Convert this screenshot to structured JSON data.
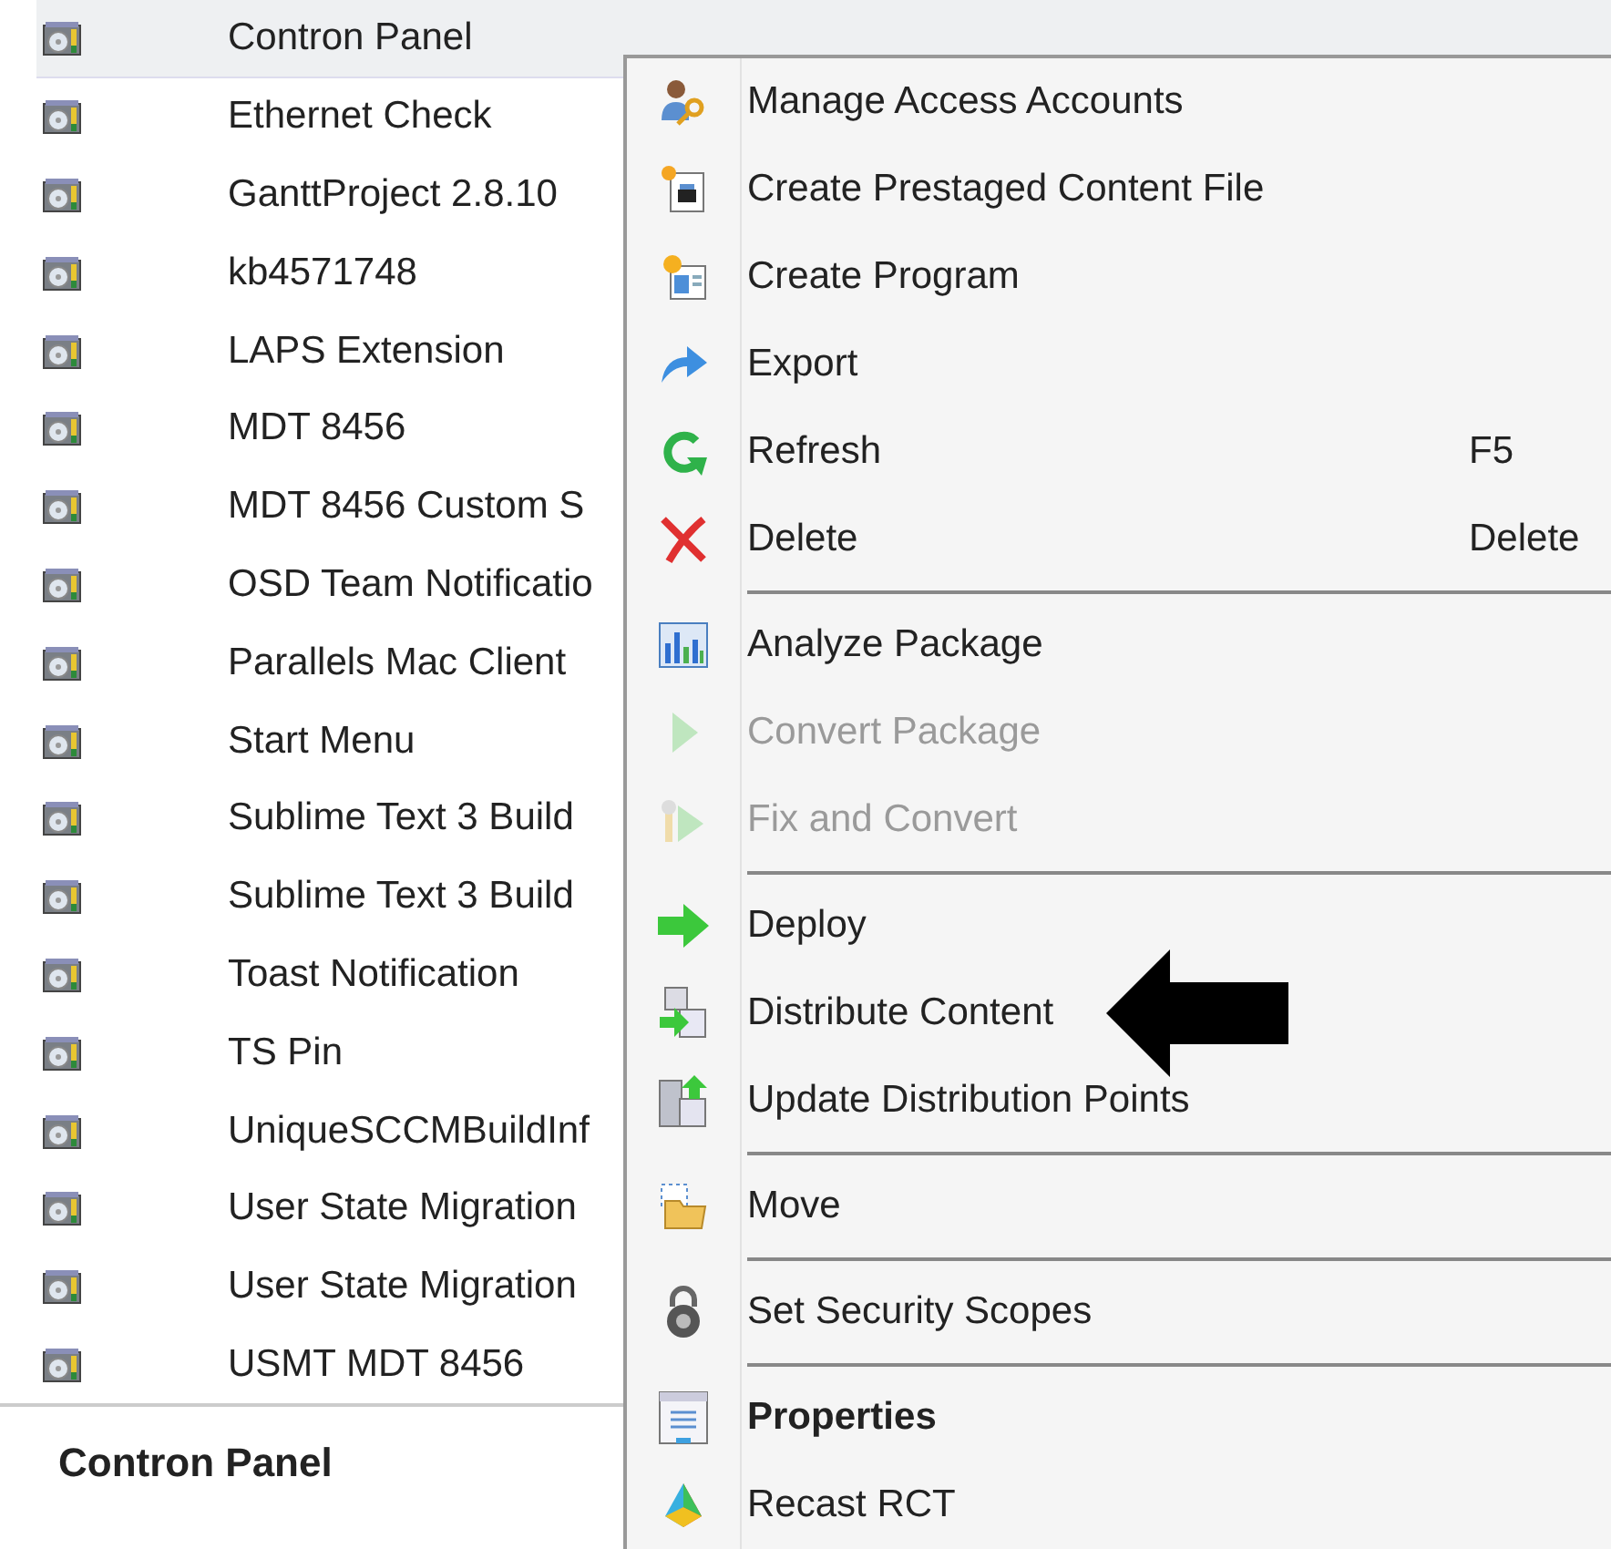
{
  "packages": [
    {
      "name": "Contron Panel",
      "selected": true
    },
    {
      "name": "Ethernet Check",
      "selected": false
    },
    {
      "name": "GanttProject 2.8.10",
      "selected": false
    },
    {
      "name": "kb4571748",
      "selected": false
    },
    {
      "name": "LAPS Extension",
      "selected": false
    },
    {
      "name": "MDT 8456",
      "selected": false
    },
    {
      "name": "MDT 8456 Custom S",
      "selected": false
    },
    {
      "name": "OSD Team Notificatio",
      "selected": false
    },
    {
      "name": "Parallels Mac Client",
      "selected": false
    },
    {
      "name": "Start Menu",
      "selected": false
    },
    {
      "name": "Sublime Text 3 Build",
      "selected": false
    },
    {
      "name": "Sublime Text 3 Build",
      "selected": false
    },
    {
      "name": "Toast Notification",
      "selected": false
    },
    {
      "name": "TS Pin",
      "selected": false
    },
    {
      "name": "UniqueSCCMBuildInf",
      "selected": false
    },
    {
      "name": "User State Migration",
      "selected": false
    },
    {
      "name": "User State Migration",
      "selected": false
    },
    {
      "name": "USMT MDT 8456",
      "selected": false
    }
  ],
  "details_title": "Contron Panel",
  "context_menu": [
    {
      "kind": "item",
      "label": "Manage Access Accounts",
      "disabled": false,
      "default": false
    },
    {
      "kind": "item",
      "label": "Create Prestaged Content File",
      "disabled": false,
      "default": false
    },
    {
      "kind": "item",
      "label": "Create Program",
      "disabled": false,
      "default": false
    },
    {
      "kind": "item",
      "label": "Export",
      "disabled": false,
      "default": false
    },
    {
      "kind": "item",
      "label": "Refresh",
      "shortcut": "F5",
      "disabled": false,
      "default": false
    },
    {
      "kind": "item",
      "label": "Delete",
      "shortcut": "Delete",
      "disabled": false,
      "default": false
    },
    {
      "kind": "separator"
    },
    {
      "kind": "item",
      "label": "Analyze Package",
      "disabled": false,
      "default": false
    },
    {
      "kind": "item",
      "label": "Convert Package",
      "disabled": true,
      "default": false
    },
    {
      "kind": "item",
      "label": "Fix and Convert",
      "disabled": true,
      "default": false
    },
    {
      "kind": "separator"
    },
    {
      "kind": "item",
      "label": "Deploy",
      "disabled": false,
      "default": false
    },
    {
      "kind": "item",
      "label": "Distribute Content",
      "disabled": false,
      "default": false,
      "pointed": true
    },
    {
      "kind": "item",
      "label": "Update Distribution Points",
      "disabled": false,
      "default": false
    },
    {
      "kind": "separator"
    },
    {
      "kind": "item",
      "label": "Move",
      "disabled": false,
      "default": false
    },
    {
      "kind": "separator"
    },
    {
      "kind": "item",
      "label": "Set Security Scopes",
      "disabled": false,
      "default": false
    },
    {
      "kind": "separator"
    },
    {
      "kind": "item",
      "label": "Properties",
      "disabled": false,
      "default": true
    },
    {
      "kind": "item",
      "label": "Recast RCT",
      "disabled": false,
      "default": false
    }
  ]
}
